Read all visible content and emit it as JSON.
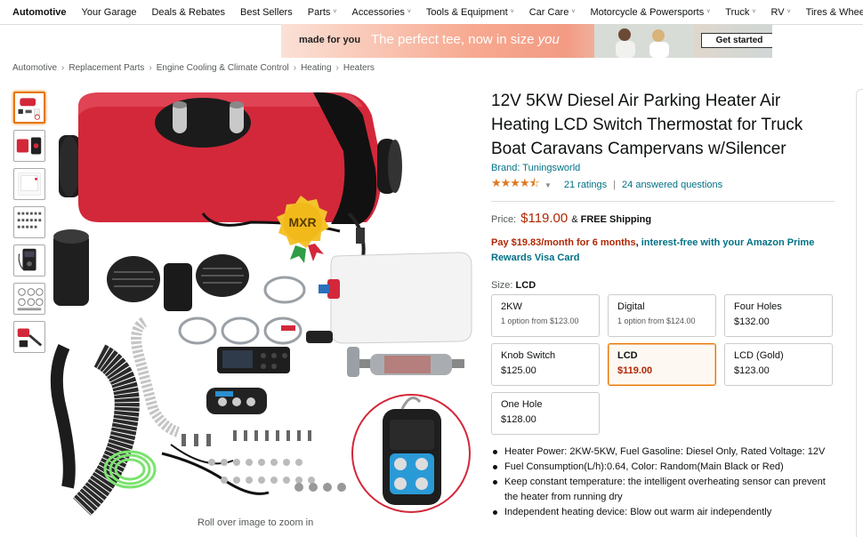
{
  "nav": {
    "items": [
      {
        "label": "Automotive",
        "bold": true,
        "caret": false
      },
      {
        "label": "Your Garage",
        "bold": false,
        "caret": false
      },
      {
        "label": "Deals & Rebates",
        "bold": false,
        "caret": false
      },
      {
        "label": "Best Sellers",
        "bold": false,
        "caret": false
      },
      {
        "label": "Parts",
        "bold": false,
        "caret": true
      },
      {
        "label": "Accessories",
        "bold": false,
        "caret": true
      },
      {
        "label": "Tools & Equipment",
        "bold": false,
        "caret": true
      },
      {
        "label": "Car Care",
        "bold": false,
        "caret": true
      },
      {
        "label": "Motorcycle & Powersports",
        "bold": false,
        "caret": true
      },
      {
        "label": "Truck",
        "bold": false,
        "caret": true
      },
      {
        "label": "RV",
        "bold": false,
        "caret": true
      },
      {
        "label": "Tires & Wheels",
        "bold": false,
        "caret": true
      }
    ]
  },
  "banner": {
    "made_for": "made for you",
    "tagline_start": "The perfect tee, now in size ",
    "tagline_italic": "you",
    "cta": "Get started"
  },
  "breadcrumb": [
    "Automotive",
    "Replacement Parts",
    "Engine Cooling & Climate Control",
    "Heating",
    "Heaters"
  ],
  "product": {
    "title": "12V 5KW Diesel Air Parking Heater Air Heating LCD Switch Thermostat for Truck Boat Caravans Campervans w/Silencer",
    "brand": "Brand: Tuningsworld",
    "stars": "★★★★⯪",
    "ratings": "21 ratings",
    "answered": "24 answered questions",
    "price_label": "Price:",
    "price": "$119.00",
    "shipping_amp": "&",
    "shipping": "FREE Shipping",
    "pay_amount": "Pay $19.83/month for 6 months",
    "pay_comma": ",",
    "pay_rest": " interest-free with your Amazon Prime Rewards Visa Card",
    "size_label": "Size:",
    "size_value": "LCD",
    "zoom_hint": "Roll over image to zoom in",
    "badge_text": "MXR"
  },
  "sizes": [
    {
      "name": "2KW",
      "sub": "1 option from $123.00",
      "price": "",
      "selected": false
    },
    {
      "name": "Digital",
      "sub": "1 option from $124.00",
      "price": "",
      "selected": false
    },
    {
      "name": "Four Holes",
      "sub": "",
      "price": "$132.00",
      "selected": false
    },
    {
      "name": "Knob Switch",
      "sub": "",
      "price": "$125.00",
      "selected": false
    },
    {
      "name": "LCD",
      "sub": "",
      "price": "$119.00",
      "selected": true
    },
    {
      "name": "LCD (Gold)",
      "sub": "",
      "price": "$123.00",
      "selected": false
    },
    {
      "name": "One Hole",
      "sub": "",
      "price": "$128.00",
      "selected": false
    }
  ],
  "bullets": [
    "Heater Power: 2KW-5KW, Fuel Gasoline: Diesel Only, Rated Voltage: 12V",
    "Fuel Consumption(L/h):0.64, Color: Random(Main Black or Red)",
    "Keep constant temperature: the intelligent overheating sensor can prevent the heater from running dry",
    "Independent heating device: Blow out warm air independently"
  ],
  "colors": {
    "link": "#007185",
    "price": "#b12704",
    "star": "#de7921",
    "selected_border": "#e77600",
    "heater_red": "#d3283a"
  }
}
